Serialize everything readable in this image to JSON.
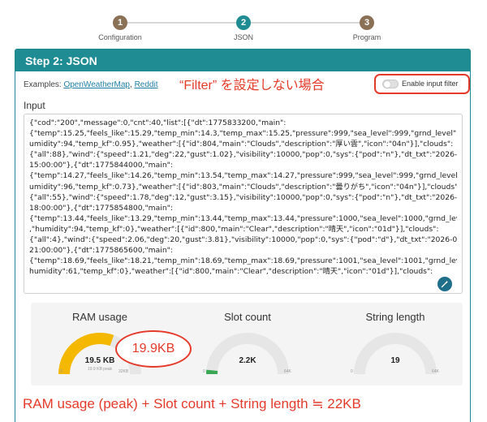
{
  "stepper": {
    "steps": [
      {
        "number": "1",
        "label": "Configuration",
        "color": "#8a7055"
      },
      {
        "number": "2",
        "label": "JSON",
        "color": "#1f8b93"
      },
      {
        "number": "3",
        "label": "Program",
        "color": "#8a7055"
      }
    ]
  },
  "card": {
    "title": "Step 2: JSON",
    "examples_prefix": "Examples: ",
    "examples": [
      "OpenWeatherMap",
      "Reddit"
    ],
    "toggle_label": "Enable input filter",
    "toggle_on": false,
    "input_label": "Input",
    "input_lines": [
      "{\"cod\":\"200\",\"message\":0,\"cnt\":40,\"list\":[{\"dt\":1775833200,\"main\":",
      "{\"temp\":15.25,\"feels_like\":15.29,\"temp_min\":14.3,\"temp_max\":15.25,\"pressure\":999,\"sea_level\":999,\"grnd_level\":989,\"h",
      "umidity\":94,\"temp_kf\":0.95},\"weather\":[{\"id\":804,\"main\":\"Clouds\",\"description\":\"厚い雲\",\"icon\":\"04n\"}],\"clouds\":",
      "{\"all\":88},\"wind\":{\"speed\":1.21,\"deg\":22,\"gust\":1.02},\"visibility\":10000,\"pop\":0,\"sys\":{\"pod\":\"n\"},\"dt_txt\":\"2026-04-10",
      "15:00:00\"},{\"dt\":1775844000,\"main\":",
      "{\"temp\":14.27,\"feels_like\":14.26,\"temp_min\":13.54,\"temp_max\":14.27,\"pressure\":999,\"sea_level\":999,\"grnd_level\":989,\"h",
      "umidity\":96,\"temp_kf\":0.73},\"weather\":[{\"id\":803,\"main\":\"Clouds\",\"description\":\"曇りがち\",\"icon\":\"04n\"}],\"clouds\":",
      "{\"all\":55},\"wind\":{\"speed\":1.78,\"deg\":12,\"gust\":3.15},\"visibility\":10000,\"pop\":0,\"sys\":{\"pod\":\"n\"},\"dt_txt\":\"2026-04-10",
      "18:00:00\"},{\"dt\":1775854800,\"main\":",
      "{\"temp\":13.44,\"feels_like\":13.29,\"temp_min\":13.44,\"temp_max\":13.44,\"pressure\":1000,\"sea_level\":1000,\"grnd_level\":990",
      ",\"humidity\":94,\"temp_kf\":0},\"weather\":[{\"id\":800,\"main\":\"Clear\",\"description\":\"晴天\",\"icon\":\"01d\"}],\"clouds\":",
      "{\"all\":4},\"wind\":{\"speed\":2.06,\"deg\":20,\"gust\":3.81},\"visibility\":10000,\"pop\":0,\"sys\":{\"pod\":\"d\"},\"dt_txt\":\"2026-04-10",
      "21:00:00\"},{\"dt\":1775865600,\"main\":",
      "{\"temp\":18.69,\"feels_like\":18.21,\"temp_min\":18.69,\"temp_max\":18.69,\"pressure\":1001,\"sea_level\":1001,\"grnd_level\":991,\"",
      "humidity\":61,\"temp_kf\":0},\"weather\":[{\"id\":800,\"main\":\"Clear\",\"description\":\"晴天\",\"icon\":\"01d\"}],\"clouds\":"
    ]
  },
  "gauges": [
    {
      "title": "RAM usage",
      "value_text": "19.5 KB",
      "peak_text": "19.9 KB peak",
      "min": "0",
      "max": "32KB",
      "fraction": 0.61,
      "color": "#f5b800"
    },
    {
      "title": "Slot count",
      "value_text": "2.2K",
      "peak_text": "",
      "min": "0",
      "max": "64K",
      "fraction": 0.034,
      "color": "#3aa757"
    },
    {
      "title": "String length",
      "value_text": "19",
      "peak_text": "",
      "min": "0",
      "max": "64K",
      "fraction": 0.0,
      "color": "#3aa757"
    }
  ],
  "annotations": {
    "filter_note": "“Filter” を設定しない場合",
    "bubble": "19.9KB",
    "summary": "RAM usage (peak) + Slot count + String length ≒ 22KB",
    "color": "#e53a2a"
  }
}
